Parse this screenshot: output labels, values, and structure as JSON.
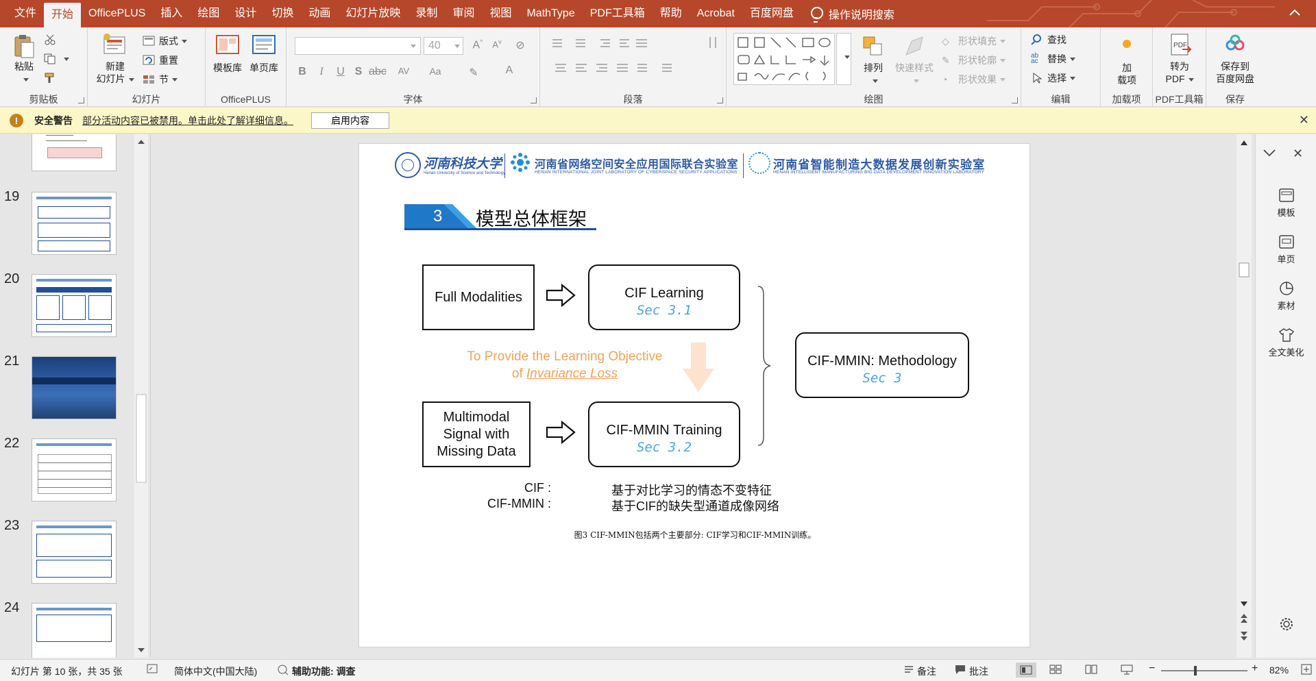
{
  "menu": {
    "tabs": [
      "文件",
      "开始",
      "OfficePLUS",
      "插入",
      "绘图",
      "设计",
      "切换",
      "动画",
      "幻灯片放映",
      "录制",
      "审阅",
      "视图",
      "MathType",
      "PDF工具箱",
      "帮助",
      "Acrobat",
      "百度网盘"
    ],
    "active_tab": "开始",
    "search_label": "操作说明搜索",
    "accent_color": "#b7472a"
  },
  "ribbon": {
    "clipboard": {
      "paste": "粘贴",
      "label": "剪贴板"
    },
    "slides": {
      "new_slide_line1": "新建",
      "new_slide_line2": "幻灯片",
      "layout": "版式",
      "reset": "重置",
      "section": "节",
      "label": "幻灯片"
    },
    "officeplus": {
      "template_lib": "模板库",
      "single_page": "单页库",
      "label": "OfficePLUS"
    },
    "font": {
      "size": "40",
      "label": "字体",
      "aa": "Aa"
    },
    "paragraph": {
      "label": "段落"
    },
    "drawing": {
      "arrange": "排列",
      "quick_style": "快速样式",
      "shape_fill": "形状填充",
      "shape_outline": "形状轮廓",
      "shape_effect": "形状效果",
      "label": "绘图"
    },
    "editing": {
      "find": "查找",
      "replace": "替换",
      "select": "选择",
      "label": "编辑"
    },
    "addins": {
      "line1": "加",
      "line2": "载项",
      "label": "加载项"
    },
    "pdf": {
      "line1": "转为",
      "line2": "PDF",
      "label": "PDF工具箱"
    },
    "save": {
      "line1": "保存到",
      "line2": "百度网盘",
      "label": "保存"
    }
  },
  "warning": {
    "title": "安全警告",
    "message": "部分活动内容已被禁用。单击此处了解详细信息。",
    "button": "启用内容"
  },
  "thumbnails": [
    {
      "num": "19"
    },
    {
      "num": "20"
    },
    {
      "num": "21"
    },
    {
      "num": "22"
    },
    {
      "num": "23"
    },
    {
      "num": "24"
    }
  ],
  "slide": {
    "section_number": "3",
    "section_title": "模型总体框架",
    "header_univ": "河南科技大学",
    "header_lab1": "河南省网络空间安全应用国际联合实验室",
    "header_lab1_en": "HENAN INTERNATIONAL JOINT LABORATORY OF CYBERSPACE SECURITY APPLICATIONS",
    "header_lab2": "河南省智能制造大数据发展创新实验室",
    "header_lab2_en": "HENAN INTELLIGENT MANUFACTURING BIG DATA DEVELOPMENT INNOVATION LABORATORY",
    "header_univ_en": "Henan University of Science and Technology",
    "diagram": {
      "full_modalities": "Full Modalities",
      "cif_learning": "CIF Learning",
      "sec_31": "Sec 3.1",
      "objective_line1": "To Provide the Learning Objective",
      "objective_of": "of ",
      "objective_loss": "Invariance Loss",
      "missing_line1": "Multimodal",
      "missing_line2": "Signal with",
      "missing_line3": "Missing Data",
      "cif_mmin_training": "CIF-MMIN Training",
      "sec_32": "Sec 3.2",
      "methodology": "CIF-MMIN: Methodology",
      "sec_3": "Sec 3"
    },
    "def_cif_term": "CIF :",
    "def_cif_desc": "基于对比学习的情态不变特征",
    "def_mmin_term": "CIF-MMIN :",
    "def_mmin_desc": "基于CIF的缺失型通道成像网络",
    "caption": "图3 CIF-MMIN包括两个主要部分: CIF学习和CIF-MMIN训练。"
  },
  "rightpane": {
    "template": "模板",
    "single": "单页",
    "material": "素材",
    "beautify": "全文美化"
  },
  "status": {
    "slide_info": "幻灯片 第 10 张，共 35 张",
    "language": "简体中文(中国大陆)",
    "accessibility": "辅助功能: 调查",
    "notes": "备注",
    "comments": "批注",
    "zoom": "82%",
    "zoom_minus": "−",
    "zoom_plus": "+"
  }
}
